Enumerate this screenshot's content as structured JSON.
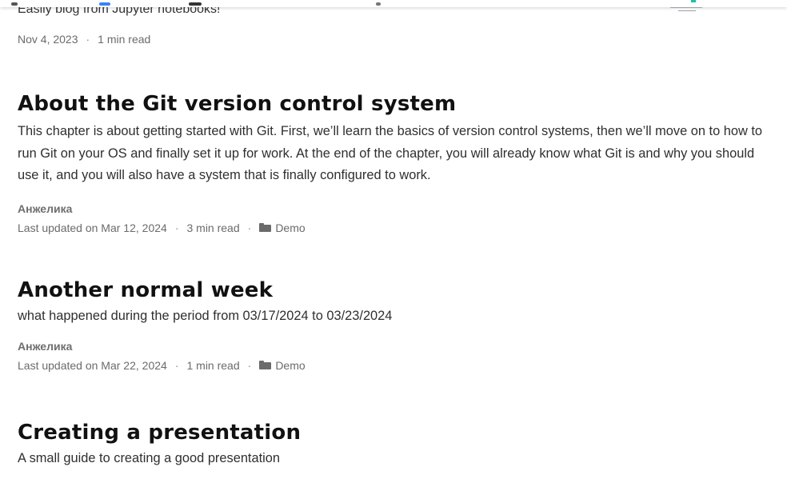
{
  "top_article": {
    "summary": "Easily blog from Jupyter notebooks!",
    "date": "Nov 4, 2023",
    "read_time": "1 min read"
  },
  "articles": [
    {
      "title": "About the Git version control system",
      "summary": "This chapter is about getting started with Git. First, we’ll learn the basics of version control systems, then we’ll move on to how to run Git on your OS and finally set it up for work. At the end of the chapter, you will already know what Git is and why you should use it, and you will also have a system that is finally configured to work.",
      "author": "Анжелика",
      "updated": "Last updated on Mar 12, 2024",
      "read_time": "3 min read",
      "category": "Demo"
    },
    {
      "title": "Another normal week",
      "summary": "what happened during the period from 03/17/2024 to 03/23/2024",
      "author": "Анжелика",
      "updated": "Last updated on Mar 22, 2024",
      "read_time": "1 min read",
      "category": "Demo"
    },
    {
      "title": "Creating a presentation",
      "summary": "A small guide to creating a good presentation"
    }
  ],
  "separator": "·",
  "icons": {
    "category": "folder-icon"
  },
  "colors": {
    "title": "#111111",
    "meta": "#6b6b6b",
    "accent": "#19c2a8"
  }
}
